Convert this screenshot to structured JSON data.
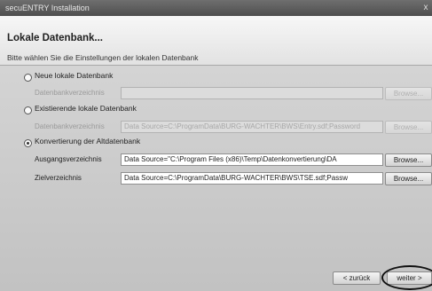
{
  "window": {
    "title": "secuENTRY Installation",
    "close_glyph": "x"
  },
  "header": {
    "title": "Lokale Datenbank...",
    "subtitle": "Bitte wählen Sie die Einstellungen der lokalen Datenbank"
  },
  "options": [
    {
      "label": "Neue lokale Datenbank",
      "checked": false,
      "fields": [
        {
          "label": "Datenbankverzeichnis",
          "value": "",
          "button": "Browse...",
          "enabled": false
        }
      ]
    },
    {
      "label": "Existierende lokale Datenbank",
      "checked": false,
      "fields": [
        {
          "label": "Datenbankverzeichnis",
          "value": "Data Source=C:\\ProgramData\\BURG-WACHTER\\BWS\\Entry.sdf;Password",
          "button": "Browse...",
          "enabled": false
        }
      ]
    },
    {
      "label": "Konvertierung der Altdatenbank",
      "checked": true,
      "fields": [
        {
          "label": "Ausgangsverzeichnis",
          "value": "Data Source=\"C:\\Program Files (x86)\\Temp\\Datenkonvertierung\\DA",
          "button": "Browse...",
          "enabled": true
        },
        {
          "label": "Zielverzeichnis",
          "value": "Data Source=C:\\ProgramData\\BURG-WACHTER\\BWS\\TSE.sdf;Passw",
          "button": "Browse...",
          "enabled": true
        }
      ]
    }
  ],
  "footer": {
    "back_label": "< zurück",
    "next_label": "weiter >"
  }
}
